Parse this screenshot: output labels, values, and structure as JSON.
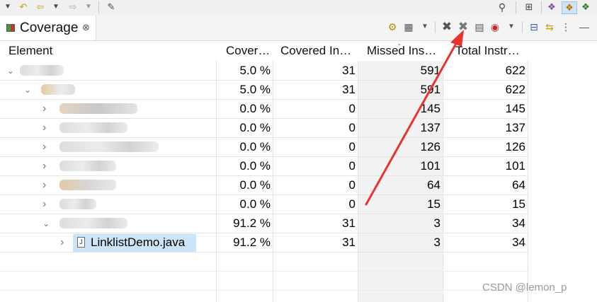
{
  "view": {
    "tab_title": "Coverage",
    "tab_close": "⊗"
  },
  "columns": [
    {
      "label": "Element"
    },
    {
      "label": "Cover…"
    },
    {
      "label": "Covered In…"
    },
    {
      "label": "Missed Ins…"
    },
    {
      "label": "Total Instr…"
    }
  ],
  "sort_indicator": "⌄",
  "rows": [
    {
      "name": "",
      "coverage": "5.0 %",
      "covered": "31",
      "missed": "591",
      "total": "622",
      "expanded": true
    },
    {
      "name": "",
      "coverage": "5.0 %",
      "covered": "31",
      "missed": "591",
      "total": "622",
      "expanded": true
    },
    {
      "name": "",
      "coverage": "0.0 %",
      "covered": "0",
      "missed": "145",
      "total": "145",
      "expanded": false
    },
    {
      "name": "",
      "coverage": "0.0 %",
      "covered": "0",
      "missed": "137",
      "total": "137",
      "expanded": false
    },
    {
      "name": "",
      "coverage": "0.0 %",
      "covered": "0",
      "missed": "126",
      "total": "126",
      "expanded": false
    },
    {
      "name": "",
      "coverage": "0.0 %",
      "covered": "0",
      "missed": "101",
      "total": "101",
      "expanded": false
    },
    {
      "name": "",
      "coverage": "0.0 %",
      "covered": "0",
      "missed": "64",
      "total": "64",
      "expanded": false
    },
    {
      "name": "",
      "coverage": "0.0 %",
      "covered": "0",
      "missed": "15",
      "total": "15",
      "expanded": false
    },
    {
      "name": "",
      "coverage": "91.2 %",
      "covered": "31",
      "missed": "3",
      "total": "34",
      "expanded": true
    },
    {
      "name": "LinklistDemo.java",
      "coverage": "91.2 %",
      "covered": "31",
      "missed": "3",
      "total": "34",
      "expanded": false
    }
  ],
  "icons": {
    "file_glyph": "J",
    "twisty_expanded": "⌄",
    "twisty_collapsed": "›"
  },
  "colors": {
    "selection": "#cce4f7",
    "annotation_arrow": "#e8332d",
    "sorted_column": "#f2f2f2"
  },
  "watermark": "CSDN @lemon_p"
}
